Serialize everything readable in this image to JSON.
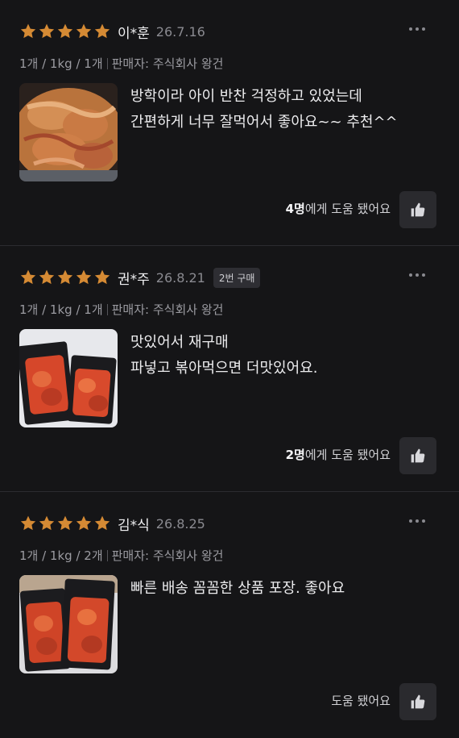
{
  "colors": {
    "background": "#151517",
    "star": "#d58a34",
    "text": "#ececee",
    "muted": "#9b9ba1"
  },
  "reviews": [
    {
      "rating": 5,
      "name": "이*훈",
      "date": "26.7.16",
      "badge": "",
      "options": [
        "1개 / 1kg / 1개",
        "판매자: 주식회사 왕건"
      ],
      "photo": "stir-fried-pork-bowl",
      "text_lines": [
        "방학이라 아이 반찬 걱정하고 있었는데",
        "간편하게 너무 잘먹어서 좋아요~~ 추천^^"
      ],
      "helpful_count": "4명",
      "helpful_suffix": "에게 도움 됐어요",
      "icons": [
        "star-icon",
        "more-icon",
        "thumbs-up-icon"
      ]
    },
    {
      "rating": 5,
      "name": "권*주",
      "date": "26.8.21",
      "badge": "2번 구매",
      "options": [
        "1개 / 1kg / 1개",
        "판매자: 주식회사 왕건"
      ],
      "photo": "two-packaged-meat-packs",
      "text_lines": [
        "맛있어서 재구매",
        "파넣고 볶아먹으면 더맛있어요."
      ],
      "helpful_count": "2명",
      "helpful_suffix": "에게 도움 됐어요",
      "icons": [
        "star-icon",
        "more-icon",
        "thumbs-up-icon"
      ]
    },
    {
      "rating": 5,
      "name": "김*식",
      "date": "26.8.25",
      "badge": "",
      "options": [
        "1개 / 1kg / 2개",
        "판매자: 주식회사 왕건"
      ],
      "photo": "two-packaged-meat-packs-stacked",
      "text_lines": [
        "빠른 배송 꼼꼼한 상품 포장. 좋아요"
      ],
      "helpful_count": "",
      "helpful_suffix": "도움 됐어요",
      "icons": [
        "star-icon",
        "more-icon",
        "thumbs-up-icon"
      ]
    }
  ]
}
